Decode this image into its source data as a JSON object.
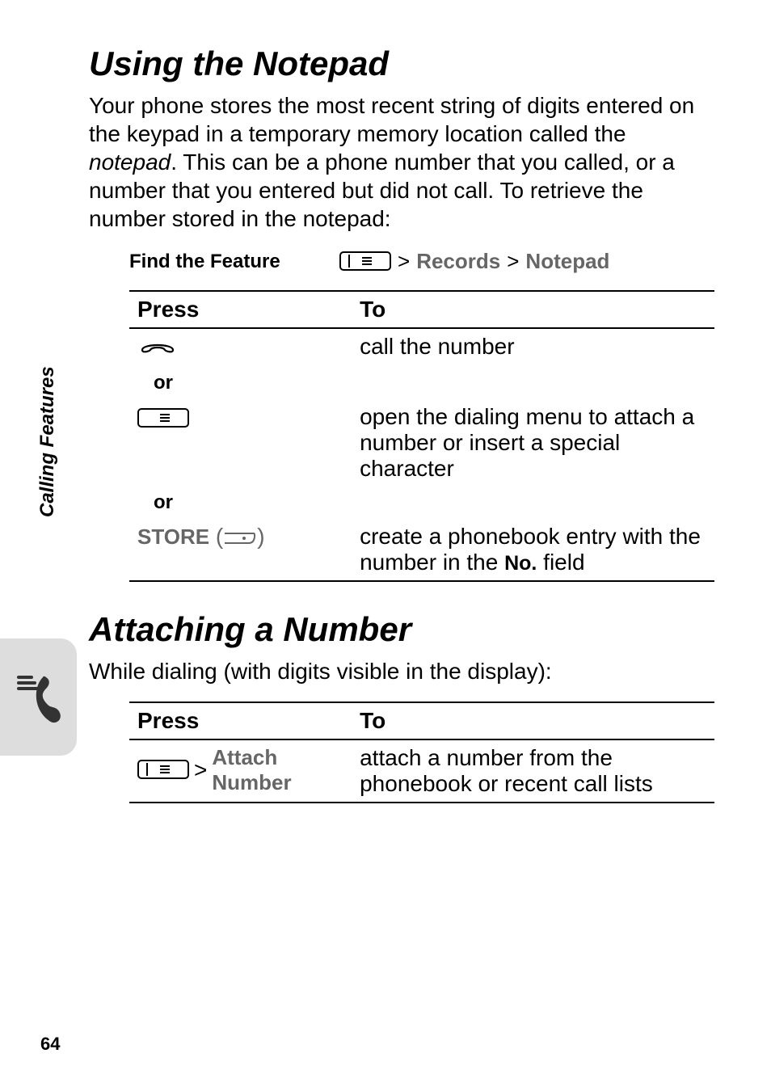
{
  "sideLabel": "Calling Features",
  "pageNumber": "64",
  "section1": {
    "heading": "Using the Notepad",
    "intro_pre": "Your phone stores the most recent string of digits entered on the keypad in a temporary memory location called the ",
    "intro_italic": "notepad",
    "intro_post": ". This can be a phone number that you called, or a number that you entered but did not call. To retrieve the number stored in the notepad:",
    "findLabel": "Find the Feature",
    "navGt": ">",
    "nav1": "Records",
    "nav2": "Notepad",
    "table": {
      "h1": "Press",
      "h2": "To",
      "row1_to": "call the number",
      "or": "or",
      "row2_to": "open the dialing menu to attach a number or insert a special character",
      "row3_press": "STORE",
      "row3_to_pre": "create a phonebook entry with the number in the ",
      "row3_to_field": "No.",
      "row3_to_post": " field"
    }
  },
  "section2": {
    "heading": "Attaching a Number",
    "intro": "While dialing (with digits visible in the display):",
    "table": {
      "h1": "Press",
      "h2": "To",
      "row1_gt": ">",
      "row1_nav": "Attach Number",
      "row1_to": "attach a number from the phonebook or recent call lists"
    }
  }
}
